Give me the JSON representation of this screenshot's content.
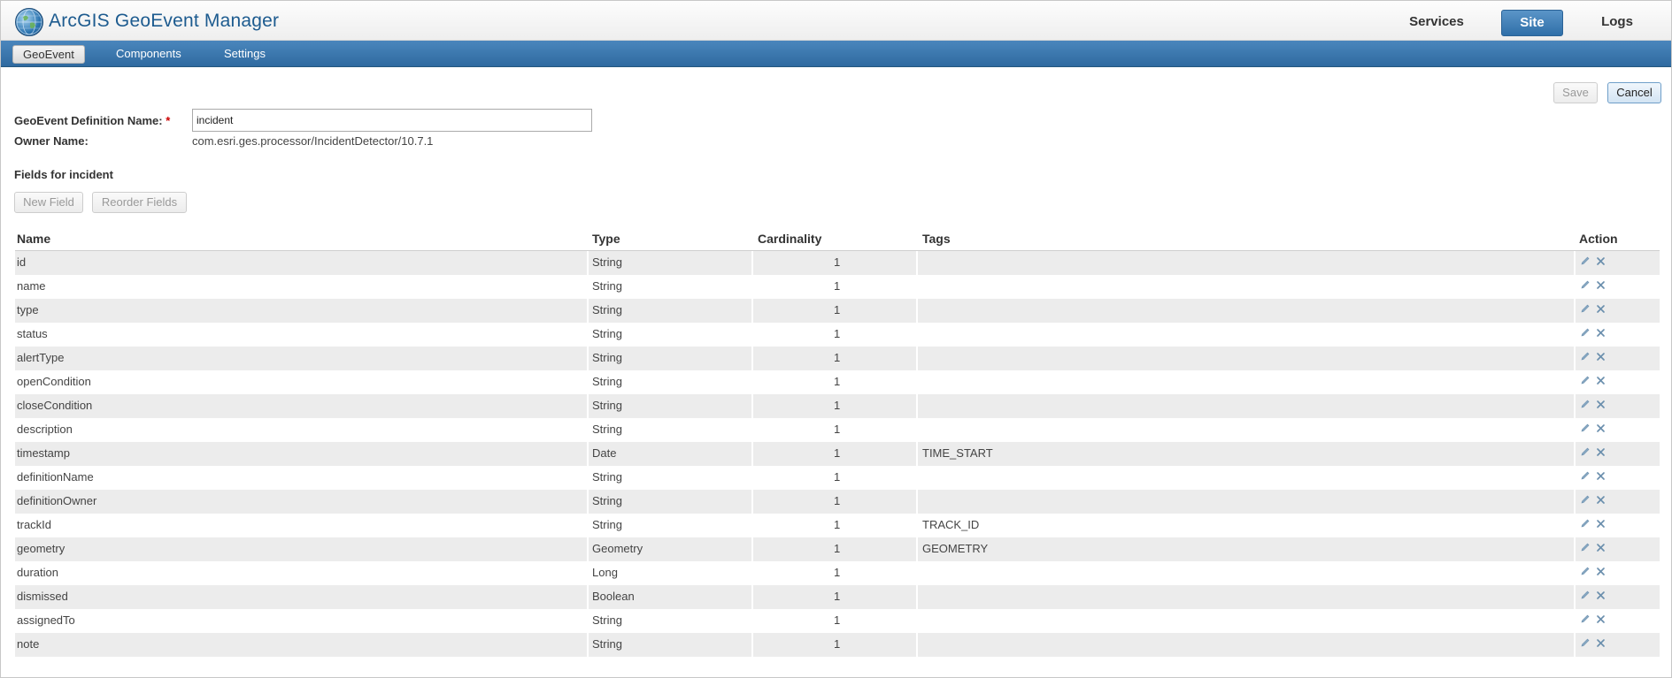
{
  "header": {
    "app_title": "ArcGIS GeoEvent Manager",
    "nav": [
      {
        "label": "Services",
        "active": false
      },
      {
        "label": "Site",
        "active": true
      },
      {
        "label": "Logs",
        "active": false
      }
    ]
  },
  "subnav": {
    "tabs": [
      {
        "label": "GeoEvent",
        "active": true
      },
      {
        "label": "Components",
        "active": false
      },
      {
        "label": "Settings",
        "active": false
      }
    ]
  },
  "actions": {
    "save_label": "Save",
    "cancel_label": "Cancel"
  },
  "form": {
    "definition_name_label": "GeoEvent Definition Name:",
    "required_marker": "*",
    "definition_name_value": "incident",
    "owner_label": "Owner Name:",
    "owner_value": "com.esri.ges.processor/IncidentDetector/10.7.1"
  },
  "fields_section": {
    "title": "Fields for incident",
    "new_field_label": "New Field",
    "reorder_label": "Reorder Fields"
  },
  "table": {
    "headers": {
      "name": "Name",
      "type": "Type",
      "cardinality": "Cardinality",
      "tags": "Tags",
      "action": "Action"
    },
    "rows": [
      {
        "name": "id",
        "type": "String",
        "cardinality": "1",
        "tags": ""
      },
      {
        "name": "name",
        "type": "String",
        "cardinality": "1",
        "tags": ""
      },
      {
        "name": "type",
        "type": "String",
        "cardinality": "1",
        "tags": ""
      },
      {
        "name": "status",
        "type": "String",
        "cardinality": "1",
        "tags": ""
      },
      {
        "name": "alertType",
        "type": "String",
        "cardinality": "1",
        "tags": ""
      },
      {
        "name": "openCondition",
        "type": "String",
        "cardinality": "1",
        "tags": ""
      },
      {
        "name": "closeCondition",
        "type": "String",
        "cardinality": "1",
        "tags": ""
      },
      {
        "name": "description",
        "type": "String",
        "cardinality": "1",
        "tags": ""
      },
      {
        "name": "timestamp",
        "type": "Date",
        "cardinality": "1",
        "tags": "TIME_START"
      },
      {
        "name": "definitionName",
        "type": "String",
        "cardinality": "1",
        "tags": ""
      },
      {
        "name": "definitionOwner",
        "type": "String",
        "cardinality": "1",
        "tags": ""
      },
      {
        "name": "trackId",
        "type": "String",
        "cardinality": "1",
        "tags": "TRACK_ID"
      },
      {
        "name": "geometry",
        "type": "Geometry",
        "cardinality": "1",
        "tags": "GEOMETRY"
      },
      {
        "name": "duration",
        "type": "Long",
        "cardinality": "1",
        "tags": ""
      },
      {
        "name": "dismissed",
        "type": "Boolean",
        "cardinality": "1",
        "tags": ""
      },
      {
        "name": "assignedTo",
        "type": "String",
        "cardinality": "1",
        "tags": ""
      },
      {
        "name": "note",
        "type": "String",
        "cardinality": "1",
        "tags": ""
      }
    ],
    "row_action_icons": [
      "pencil-icon",
      "close-icon"
    ]
  }
}
